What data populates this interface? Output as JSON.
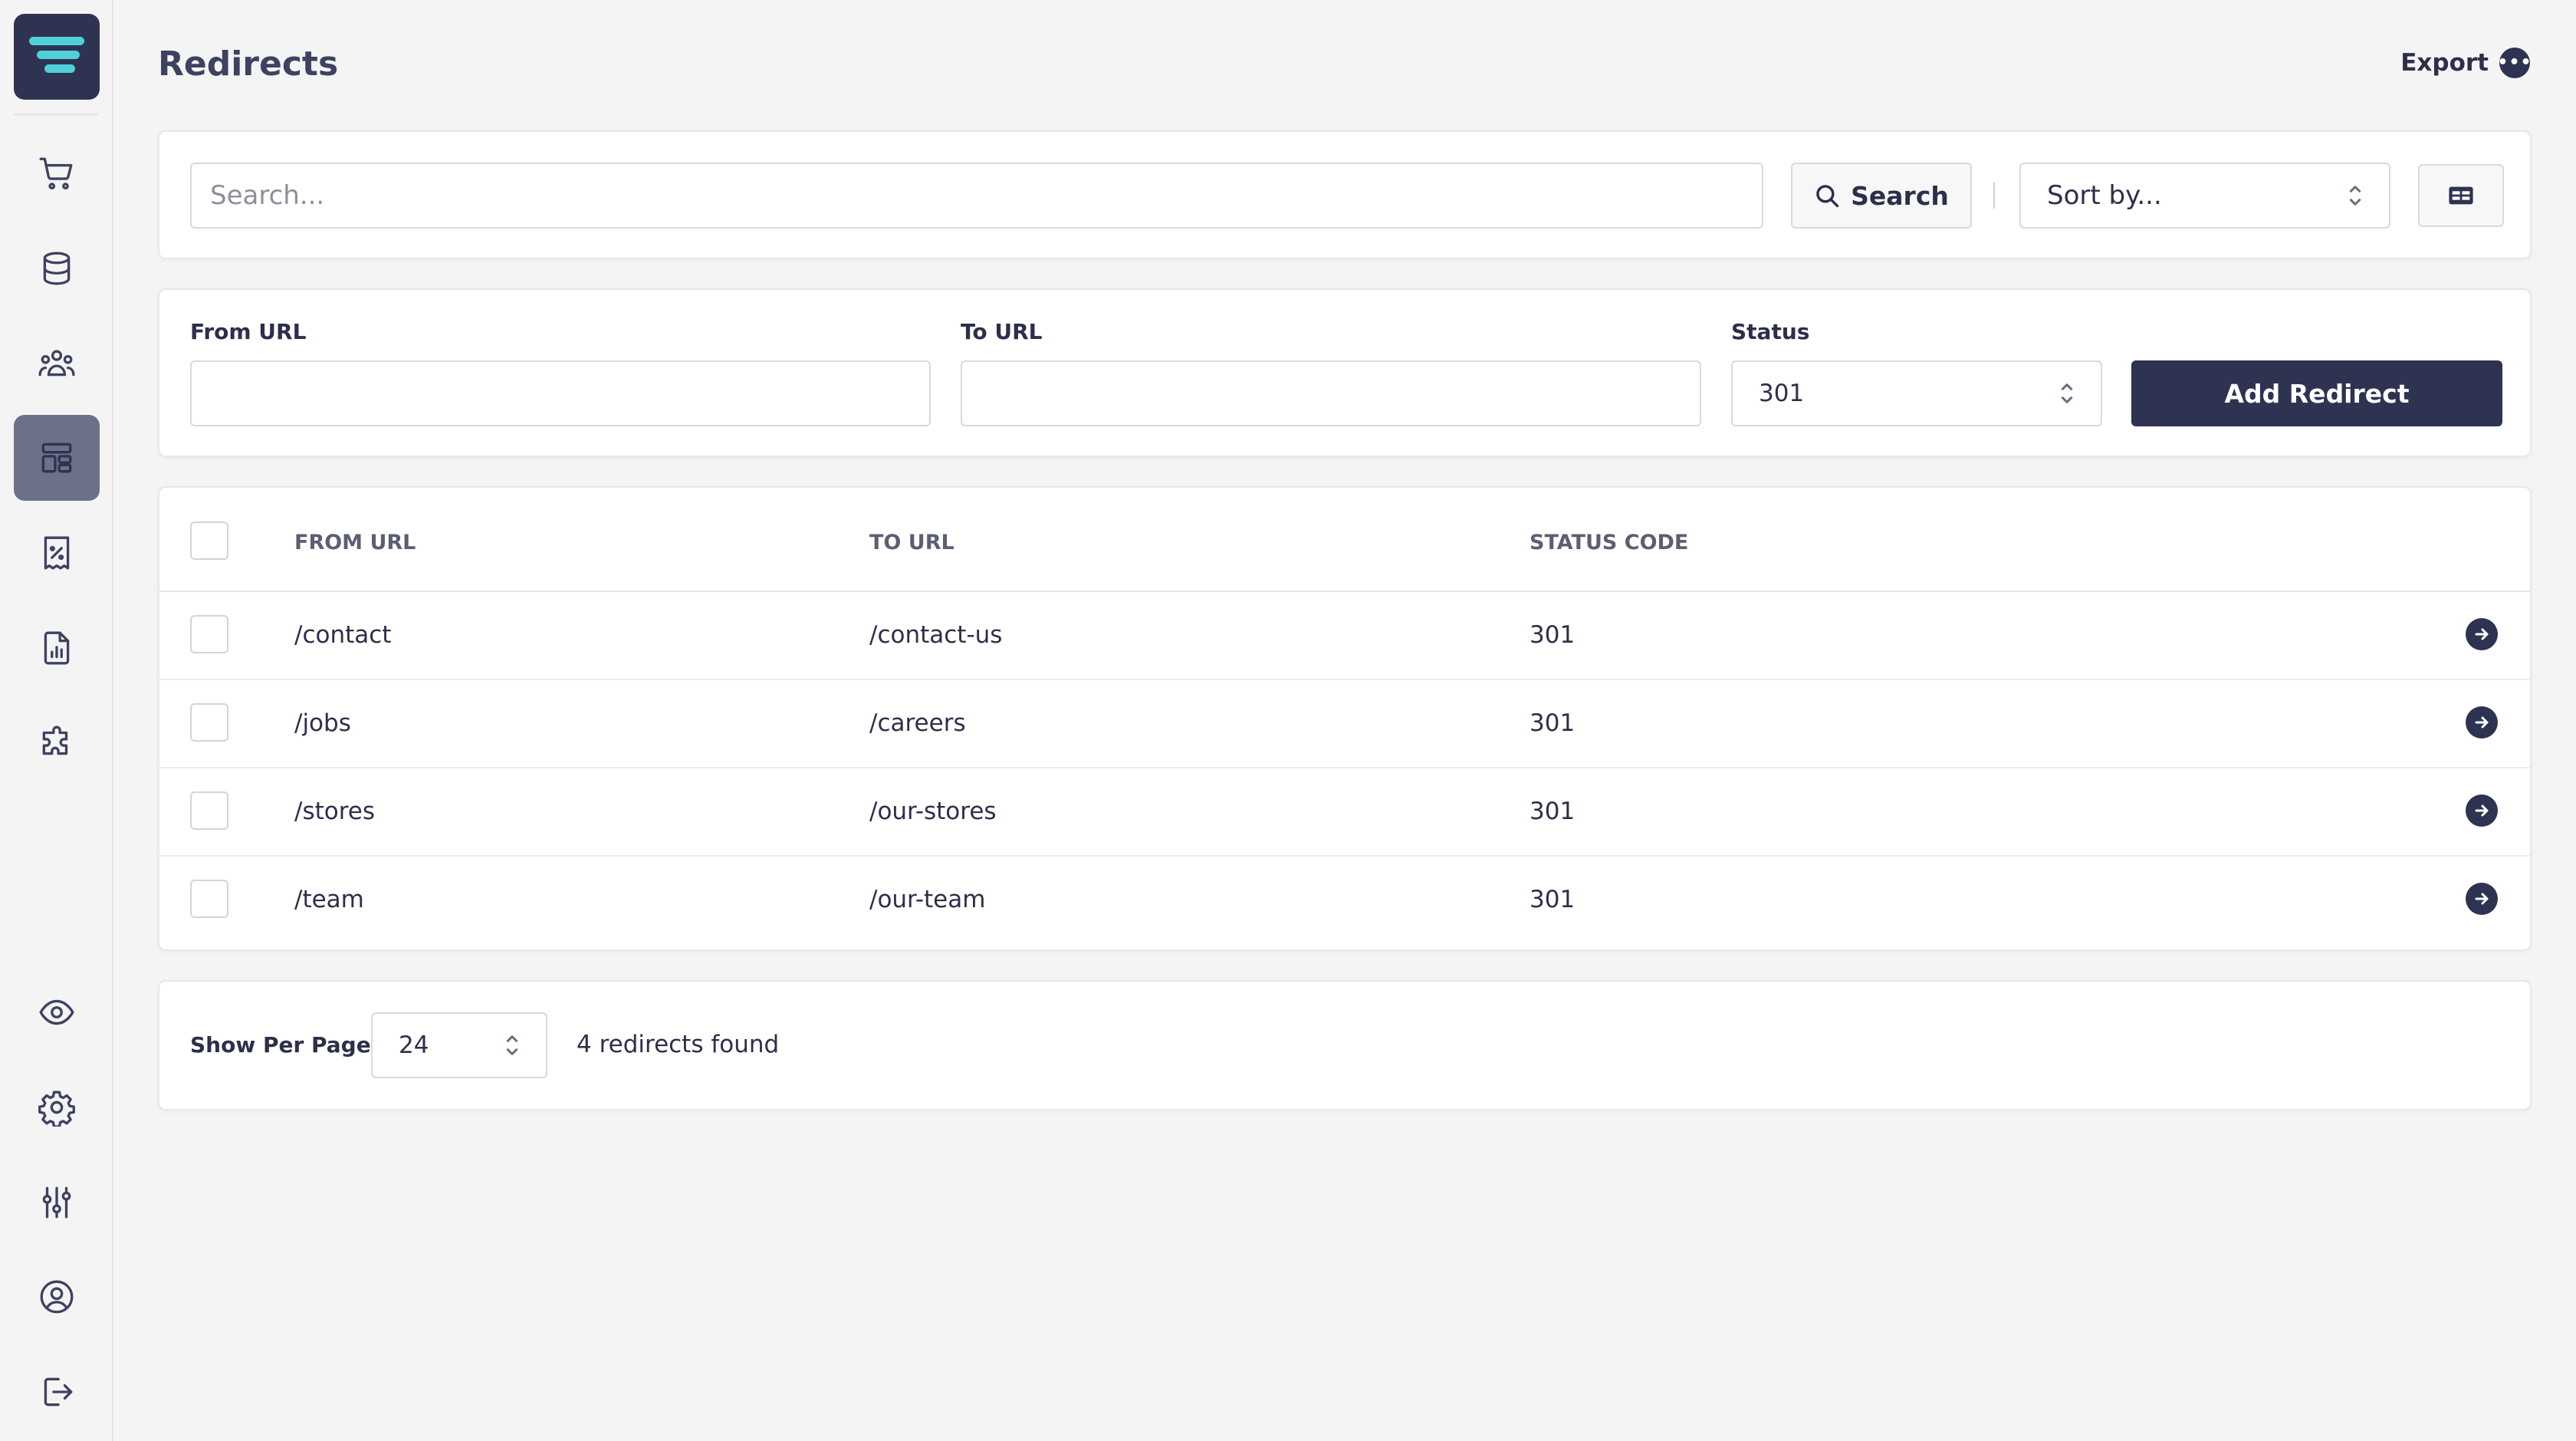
{
  "page": {
    "title": "Redirects",
    "export_label": "Export",
    "export_icon": "more-dots-icon"
  },
  "sidebar": {
    "logo": "app-logo",
    "items": [
      {
        "name": "orders",
        "icon": "cart-icon",
        "active": false
      },
      {
        "name": "database",
        "icon": "database-icon",
        "active": false
      },
      {
        "name": "customers",
        "icon": "users-icon",
        "active": false
      },
      {
        "name": "layout",
        "icon": "layout-icon",
        "active": true
      },
      {
        "name": "discounts",
        "icon": "receipt-percent-icon",
        "active": false
      },
      {
        "name": "reports",
        "icon": "report-icon",
        "active": false
      },
      {
        "name": "plugins",
        "icon": "puzzle-icon",
        "active": false
      }
    ],
    "bottom_items": [
      {
        "name": "preview",
        "icon": "eye-icon"
      },
      {
        "name": "settings",
        "icon": "gear-icon"
      },
      {
        "name": "adjustments",
        "icon": "sliders-icon"
      },
      {
        "name": "account",
        "icon": "user-circle-icon"
      },
      {
        "name": "logout",
        "icon": "logout-icon"
      }
    ]
  },
  "search": {
    "placeholder": "Search...",
    "button_label": "Search",
    "sort_placeholder": "Sort by..."
  },
  "form": {
    "from_label": "From URL",
    "to_label": "To URL",
    "status_label": "Status",
    "from_value": "",
    "to_value": "",
    "status_value": "301",
    "add_button": "Add Redirect"
  },
  "table": {
    "columns": [
      "FROM URL",
      "TO URL",
      "STATUS CODE"
    ],
    "rows": [
      {
        "from": "/contact",
        "to": "/contact-us",
        "status": "301"
      },
      {
        "from": "/jobs",
        "to": "/careers",
        "status": "301"
      },
      {
        "from": "/stores",
        "to": "/our-stores",
        "status": "301"
      },
      {
        "from": "/team",
        "to": "/our-team",
        "status": "301"
      }
    ]
  },
  "footer": {
    "per_page_label": "Show Per Page",
    "per_page_value": "24",
    "found_text": "4 redirects found"
  },
  "colors": {
    "primary": "#2f3352",
    "accent": "#4fd1d9",
    "active_nav": "#6b7288",
    "background": "#f4f4f5"
  }
}
